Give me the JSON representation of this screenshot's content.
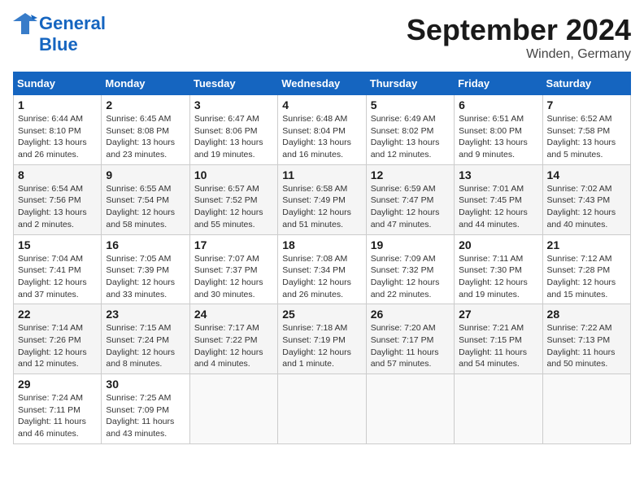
{
  "header": {
    "logo_line1": "General",
    "logo_line2": "Blue",
    "month_title": "September 2024",
    "location": "Winden, Germany"
  },
  "weekdays": [
    "Sunday",
    "Monday",
    "Tuesday",
    "Wednesday",
    "Thursday",
    "Friday",
    "Saturday"
  ],
  "weeks": [
    [
      {
        "day": "1",
        "info": "Sunrise: 6:44 AM\nSunset: 8:10 PM\nDaylight: 13 hours\nand 26 minutes."
      },
      {
        "day": "2",
        "info": "Sunrise: 6:45 AM\nSunset: 8:08 PM\nDaylight: 13 hours\nand 23 minutes."
      },
      {
        "day": "3",
        "info": "Sunrise: 6:47 AM\nSunset: 8:06 PM\nDaylight: 13 hours\nand 19 minutes."
      },
      {
        "day": "4",
        "info": "Sunrise: 6:48 AM\nSunset: 8:04 PM\nDaylight: 13 hours\nand 16 minutes."
      },
      {
        "day": "5",
        "info": "Sunrise: 6:49 AM\nSunset: 8:02 PM\nDaylight: 13 hours\nand 12 minutes."
      },
      {
        "day": "6",
        "info": "Sunrise: 6:51 AM\nSunset: 8:00 PM\nDaylight: 13 hours\nand 9 minutes."
      },
      {
        "day": "7",
        "info": "Sunrise: 6:52 AM\nSunset: 7:58 PM\nDaylight: 13 hours\nand 5 minutes."
      }
    ],
    [
      {
        "day": "8",
        "info": "Sunrise: 6:54 AM\nSunset: 7:56 PM\nDaylight: 13 hours\nand 2 minutes."
      },
      {
        "day": "9",
        "info": "Sunrise: 6:55 AM\nSunset: 7:54 PM\nDaylight: 12 hours\nand 58 minutes."
      },
      {
        "day": "10",
        "info": "Sunrise: 6:57 AM\nSunset: 7:52 PM\nDaylight: 12 hours\nand 55 minutes."
      },
      {
        "day": "11",
        "info": "Sunrise: 6:58 AM\nSunset: 7:49 PM\nDaylight: 12 hours\nand 51 minutes."
      },
      {
        "day": "12",
        "info": "Sunrise: 6:59 AM\nSunset: 7:47 PM\nDaylight: 12 hours\nand 47 minutes."
      },
      {
        "day": "13",
        "info": "Sunrise: 7:01 AM\nSunset: 7:45 PM\nDaylight: 12 hours\nand 44 minutes."
      },
      {
        "day": "14",
        "info": "Sunrise: 7:02 AM\nSunset: 7:43 PM\nDaylight: 12 hours\nand 40 minutes."
      }
    ],
    [
      {
        "day": "15",
        "info": "Sunrise: 7:04 AM\nSunset: 7:41 PM\nDaylight: 12 hours\nand 37 minutes."
      },
      {
        "day": "16",
        "info": "Sunrise: 7:05 AM\nSunset: 7:39 PM\nDaylight: 12 hours\nand 33 minutes."
      },
      {
        "day": "17",
        "info": "Sunrise: 7:07 AM\nSunset: 7:37 PM\nDaylight: 12 hours\nand 30 minutes."
      },
      {
        "day": "18",
        "info": "Sunrise: 7:08 AM\nSunset: 7:34 PM\nDaylight: 12 hours\nand 26 minutes."
      },
      {
        "day": "19",
        "info": "Sunrise: 7:09 AM\nSunset: 7:32 PM\nDaylight: 12 hours\nand 22 minutes."
      },
      {
        "day": "20",
        "info": "Sunrise: 7:11 AM\nSunset: 7:30 PM\nDaylight: 12 hours\nand 19 minutes."
      },
      {
        "day": "21",
        "info": "Sunrise: 7:12 AM\nSunset: 7:28 PM\nDaylight: 12 hours\nand 15 minutes."
      }
    ],
    [
      {
        "day": "22",
        "info": "Sunrise: 7:14 AM\nSunset: 7:26 PM\nDaylight: 12 hours\nand 12 minutes."
      },
      {
        "day": "23",
        "info": "Sunrise: 7:15 AM\nSunset: 7:24 PM\nDaylight: 12 hours\nand 8 minutes."
      },
      {
        "day": "24",
        "info": "Sunrise: 7:17 AM\nSunset: 7:22 PM\nDaylight: 12 hours\nand 4 minutes."
      },
      {
        "day": "25",
        "info": "Sunrise: 7:18 AM\nSunset: 7:19 PM\nDaylight: 12 hours\nand 1 minute."
      },
      {
        "day": "26",
        "info": "Sunrise: 7:20 AM\nSunset: 7:17 PM\nDaylight: 11 hours\nand 57 minutes."
      },
      {
        "day": "27",
        "info": "Sunrise: 7:21 AM\nSunset: 7:15 PM\nDaylight: 11 hours\nand 54 minutes."
      },
      {
        "day": "28",
        "info": "Sunrise: 7:22 AM\nSunset: 7:13 PM\nDaylight: 11 hours\nand 50 minutes."
      }
    ],
    [
      {
        "day": "29",
        "info": "Sunrise: 7:24 AM\nSunset: 7:11 PM\nDaylight: 11 hours\nand 46 minutes."
      },
      {
        "day": "30",
        "info": "Sunrise: 7:25 AM\nSunset: 7:09 PM\nDaylight: 11 hours\nand 43 minutes."
      },
      {
        "day": "",
        "info": ""
      },
      {
        "day": "",
        "info": ""
      },
      {
        "day": "",
        "info": ""
      },
      {
        "day": "",
        "info": ""
      },
      {
        "day": "",
        "info": ""
      }
    ]
  ]
}
